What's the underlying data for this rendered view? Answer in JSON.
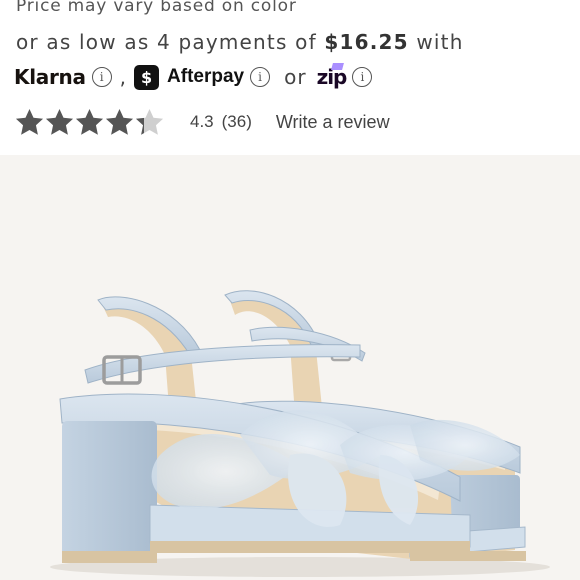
{
  "pricing": {
    "note": "Price may vary based on color",
    "installments_prefix": "or as low as 4 payments of ",
    "installment_amount": "$16.25",
    "installments_suffix": " with"
  },
  "payment_providers": {
    "klarna": "Klarna",
    "separator": ",",
    "afterpay_badge": "$",
    "afterpay": "Afterpay",
    "or": "or",
    "zip": "zip",
    "info_glyph": "i"
  },
  "reviews": {
    "stars_filled": 4.3,
    "stars_total": 5,
    "rating": "4.3",
    "count": "(36)",
    "write_review": "Write a review"
  },
  "colors": {
    "star": "#555555",
    "star_empty": "#cfcfcf",
    "image_bg": "#f6f4f1",
    "sandal": "#c9d8e6"
  },
  "product_image": {
    "alt_subject": "light blue platform sandals with tulle bow"
  }
}
